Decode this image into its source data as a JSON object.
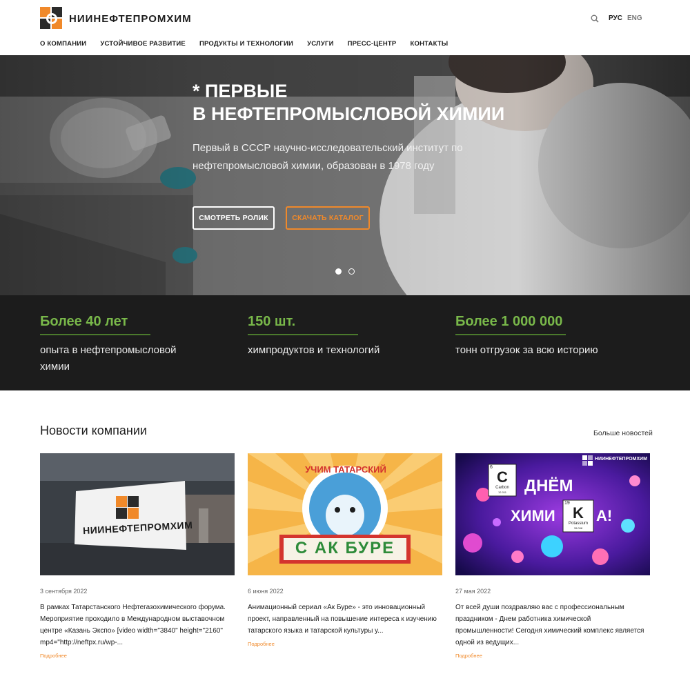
{
  "header": {
    "logo_text": "НИИНЕФТЕПРОМХИМ",
    "lang_ru": "РУС",
    "lang_en": "ENG",
    "nav": [
      "О КОМПАНИИ",
      "УСТОЙЧИВОЕ РАЗВИТИЕ",
      "ПРОДУКТЫ И ТЕХНОЛОГИИ",
      "УСЛУГИ",
      "ПРЕСС-ЦЕНТР",
      "КОНТАКТЫ"
    ]
  },
  "hero": {
    "title_line1": "* ПЕРВЫЕ",
    "title_line2": "В НЕФТЕПРОМЫСЛОВОЙ ХИМИИ",
    "subtitle": "Первый в СССР научно-исследовательский институт по нефтепромысловой химии, образован в 1978 году",
    "btn_video": "СМОТРЕТЬ РОЛИК",
    "btn_catalog": "СКАЧАТЬ КАТАЛОГ",
    "slides_total": 2,
    "slide_active": 1
  },
  "stats": [
    {
      "value": "Более 40 лет",
      "desc": "опыта в нефтепромысловой химии"
    },
    {
      "value": "150 шт.",
      "desc": "химпродуктов и технологий"
    },
    {
      "value": "Более 1 000 000",
      "desc": "тонн отгрузок за всю историю"
    }
  ],
  "news": {
    "title": "Новости компании",
    "more_label": "Больше новостей",
    "items": [
      {
        "date": "3 сентября 2022",
        "text": "В рамках Татарстанского Нефтегазохимического форума. Мероприятие проходило в Международном выставочном центре «Казань Экспо» [video width=\"3840\" height=\"2160\" mp4=\"http://neftpx.ru/wp-...",
        "more": "Подробнее",
        "image_label": "НИИНЕФТЕПРОМХИМ"
      },
      {
        "date": "6 июня 2022",
        "text": "Анимационный сериал «Ак Буре» - это инновационный проект, направленный на повышение интереса к изучению татарского языка и татарской культуры у...",
        "more": "Подробнее",
        "image_top": "УЧИМ ТАТАРСКИЙ",
        "image_bottom": "С АК БУРЕ"
      },
      {
        "date": "27 мая 2022",
        "text": "От всей души поздравляю вас с профессиональным праздником - Днем работника химической промышленности! Сегодня химический комплекс является одной из ведущих...",
        "more": "Подробнее",
        "image_logo": "НИИНЕФТЕПРОМХИМ",
        "image_line1": "ДНЁМ",
        "image_line2_a": "ХИМИ",
        "image_line2_b": "А!",
        "c_num": "6",
        "c_sym": "C",
        "c_name": "Carbon",
        "c_mass": "12.011",
        "k_num": "19",
        "k_sym": "K",
        "k_name": "Potassium",
        "k_mass": "39.098"
      }
    ]
  }
}
